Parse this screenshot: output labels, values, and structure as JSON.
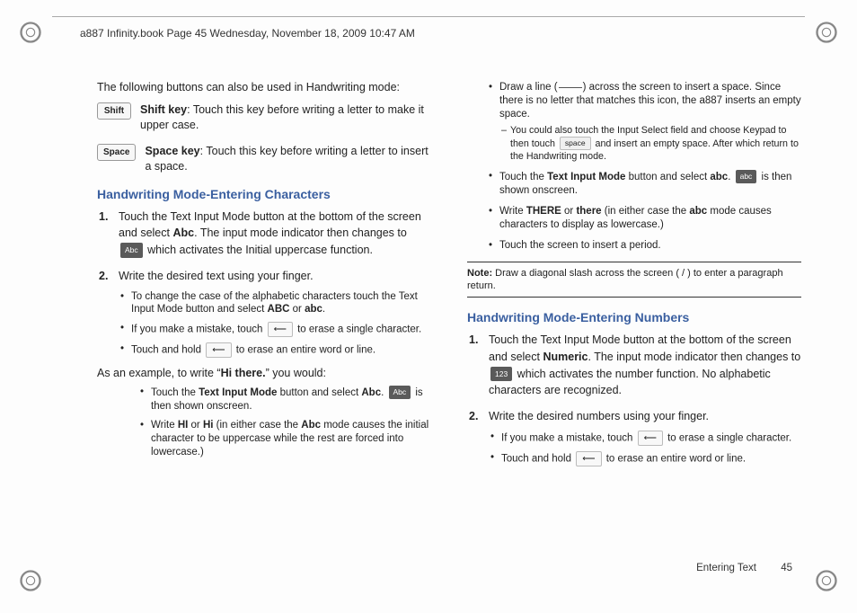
{
  "header": "a887 Infinity.book  Page 45  Wednesday, November 18, 2009  10:47 AM",
  "col1": {
    "intro": "The following buttons can also be used in Handwriting mode:",
    "shift_key_label": "Shift",
    "shift_key_bold": "Shift key",
    "shift_key_rest": ": Touch this key before writing a letter to make it upper case.",
    "space_key_label": "Space",
    "space_key_bold": "Space key",
    "space_key_rest": ": Touch this key before writing a letter to insert a space.",
    "section1_title": "Handwriting Mode-Entering Characters",
    "step1_num": "1.",
    "step1_a": "Touch the Text Input Mode button at the bottom of the screen and select ",
    "step1_bold1": "Abc",
    "step1_b": ". The input mode indicator then changes to ",
    "step1_icon": "Abc",
    "step1_c": " which activates the Initial uppercase function.",
    "step2_num": "2.",
    "step2_text": "Write the desired text using your finger.",
    "sub1_a": "To change the case of the alphabetic characters touch the Text Input Mode button and select ",
    "sub1_b1": "ABC",
    "sub1_or": " or ",
    "sub1_b2": "abc",
    "sub1_c": ".",
    "sub2_a": "If you make a mistake, touch ",
    "sub2_b": " to erase a single character.",
    "sub3_a": "Touch and hold ",
    "sub3_b": " to erase an entire word or line.",
    "example_intro_a": "As an example, to write “",
    "example_intro_bold": "Hi there.",
    "example_intro_b": "” you would:",
    "ex1_a": "Touch the ",
    "ex1_b1": "Text Input Mode",
    "ex1_b": " button and select ",
    "ex1_b2": "Abc",
    "ex1_c": ". ",
    "ex1_icon": "Abc",
    "ex1_d": " is then shown onscreen.",
    "ex2_a": "Write ",
    "ex2_b1": "HI",
    "ex2_or": " or ",
    "ex2_b2": "Hi",
    "ex2_b": " (in either case the ",
    "ex2_b3": "Abc",
    "ex2_c": " mode causes the initial character to be uppercase while the rest are forced into lowercase.)"
  },
  "col2": {
    "top1_a": "Draw a line (",
    "top1_b": ") across the screen to insert a space. Since there is no letter that matches this icon, the a887 inserts an empty space.",
    "top1_sub_a": "You could also touch the Input Select field and choose Keypad to then touch ",
    "top1_sub_icon": "space",
    "top1_sub_b": " and insert an empty space. After which return to the Handwriting mode.",
    "top2_a": "Touch the ",
    "top2_b1": "Text Input Mode",
    "top2_b": " button and select ",
    "top2_b2": "abc",
    "top2_c": ". ",
    "top2_icon": "abc",
    "top2_d": " is then shown onscreen.",
    "top3_a": "Write ",
    "top3_b1": "THERE",
    "top3_or": " or ",
    "top3_b2": "there",
    "top3_b": " (in either case the ",
    "top3_b3": "abc",
    "top3_c": " mode causes characters to display as lowercase.)",
    "top4": "Touch the screen to insert a period.",
    "note_bold": "Note:",
    "note_text": " Draw a diagonal slash across the screen ( / ) to enter a paragraph return.",
    "section2_title": "Handwriting Mode-Entering Numbers",
    "nstep1_num": "1.",
    "nstep1_a": "Touch the Text Input Mode button at the bottom of the screen and select ",
    "nstep1_bold": "Numeric",
    "nstep1_b": ". The input mode indicator then changes to ",
    "nstep1_icon": "123",
    "nstep1_c": " which activates the number function. No alphabetic characters are recognized.",
    "nstep2_num": "2.",
    "nstep2_text": "Write the desired numbers using your finger.",
    "nsub1_a": "If you make a mistake, touch ",
    "nsub1_b": " to erase a single character.",
    "nsub2_a": "Touch and hold ",
    "nsub2_b": " to erase an entire word or line."
  },
  "footer": {
    "section": "Entering Text",
    "page": "45"
  }
}
